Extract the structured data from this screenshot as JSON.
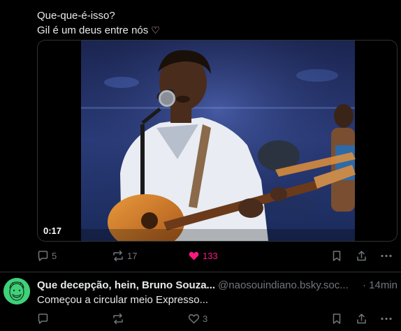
{
  "post1": {
    "text_line1": "Que-que-é-isso?",
    "text_line2": "Gil é um deus entre nós",
    "emoji": "♡",
    "video": {
      "time": "0:17"
    },
    "actions": {
      "reply_count": "5",
      "repost_count": "17",
      "like_count": "133",
      "liked": true
    }
  },
  "post2": {
    "author_name": "Que decepção, hein, Bruno Souza...",
    "author_handle": "@naosouindiano.bsky.soc...",
    "time": "· 14min",
    "text": "Começou a circular meio Expresso...",
    "actions": {
      "reply_count": "",
      "repost_count": "",
      "like_count": "3"
    }
  },
  "colors": {
    "background": "#000000",
    "text": "#e7e9ea",
    "muted": "#71767b",
    "like": "#f91880",
    "avatar": "#3ed17a",
    "divider": "#2f3336"
  },
  "icons": {
    "reply": "speech-bubble-icon",
    "repost": "repost-arrows-icon",
    "like": "heart-icon",
    "bookmark": "bookmark-icon",
    "share": "share-upload-icon",
    "more": "ellipsis-icon"
  }
}
